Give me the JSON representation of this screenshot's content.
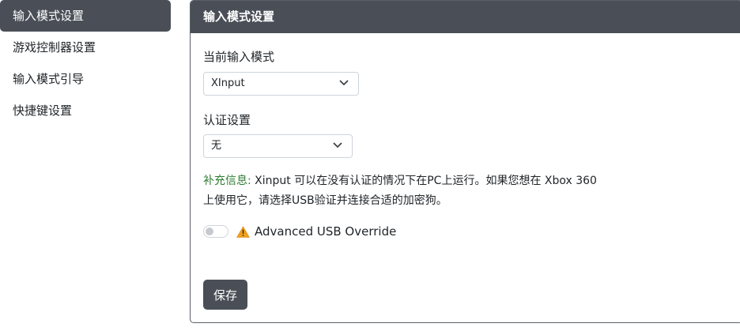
{
  "sidebar": {
    "items": [
      {
        "label": "输入模式设置",
        "active": true
      },
      {
        "label": "游戏控制器设置",
        "active": false
      },
      {
        "label": "输入模式引导",
        "active": false
      },
      {
        "label": "快捷键设置",
        "active": false
      }
    ]
  },
  "card": {
    "title": "输入模式设置",
    "input_mode": {
      "label": "当前输入模式",
      "value": "XInput"
    },
    "auth": {
      "label": "认证设置",
      "value": "无"
    },
    "info": {
      "label": "补充信息:",
      "text": "Xinput 可以在没有认证的情况下在PC上运行。如果您想在 Xbox 360 上使用它，请选择USB验证并连接合适的加密狗。"
    },
    "override": {
      "label": "Advanced USB Override",
      "enabled": false,
      "icon": "warning-icon"
    },
    "save_label": "保存"
  },
  "colors": {
    "dark": "#4a4f57",
    "info_label": "#2e7d32",
    "warning": "#f0a020"
  }
}
